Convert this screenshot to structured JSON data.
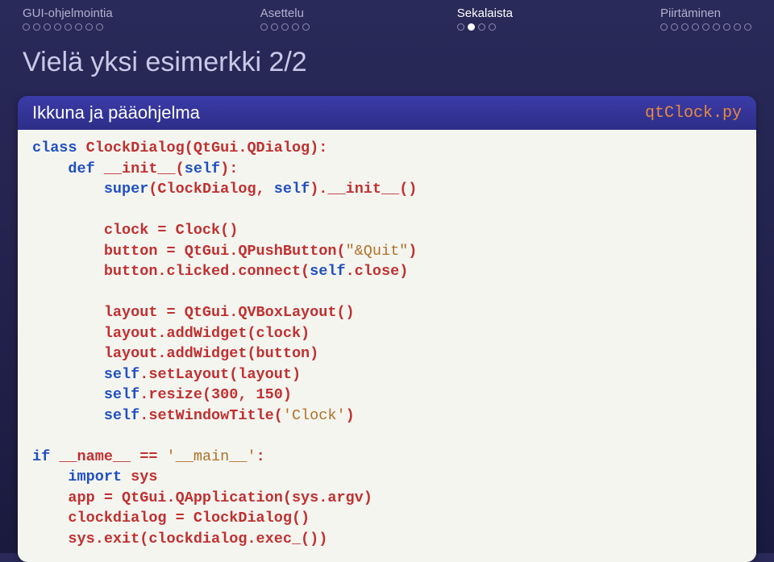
{
  "nav": {
    "items": [
      {
        "label": "GUI-ohjelmointia",
        "dot_count": 8,
        "filled_index": -1
      },
      {
        "label": "Asettelu",
        "dot_count": 5,
        "filled_index": -1
      },
      {
        "label": "Sekalaista",
        "dot_count": 4,
        "filled_index": 1
      },
      {
        "label": "Piirtäminen",
        "dot_count": 9,
        "filled_index": -1
      }
    ],
    "active_index": 2
  },
  "title": "Vielä yksi esimerkki 2/2",
  "block": {
    "heading": "Ikkuna ja pääohjelma",
    "filename": "qtClock.py"
  },
  "code": {
    "lines": [
      {
        "indent": 0,
        "parts": [
          {
            "t": "class",
            "c": "blue"
          },
          {
            "t": " ClockDialog(QtGui.QDialog):",
            "c": "red"
          }
        ]
      },
      {
        "indent": 1,
        "parts": [
          {
            "t": "def",
            "c": "blue"
          },
          {
            "t": " __init__(",
            "c": "red"
          },
          {
            "t": "self",
            "c": "blue"
          },
          {
            "t": "):",
            "c": "red"
          }
        ]
      },
      {
        "indent": 2,
        "parts": [
          {
            "t": "super",
            "c": "blue"
          },
          {
            "t": "(ClockDialog, ",
            "c": "red"
          },
          {
            "t": "self",
            "c": "blue"
          },
          {
            "t": ").__init__()",
            "c": "red"
          }
        ]
      },
      {
        "gap": true
      },
      {
        "indent": 2,
        "parts": [
          {
            "t": "clock = Clock()",
            "c": "red"
          }
        ]
      },
      {
        "indent": 2,
        "parts": [
          {
            "t": "button = QtGui.QPushButton(",
            "c": "red"
          },
          {
            "t": "\"&Quit\"",
            "c": "str"
          },
          {
            "t": ")",
            "c": "red"
          }
        ]
      },
      {
        "indent": 2,
        "parts": [
          {
            "t": "button.clicked.connect(",
            "c": "red"
          },
          {
            "t": "self",
            "c": "blue"
          },
          {
            "t": ".close)",
            "c": "red"
          }
        ]
      },
      {
        "gap": true
      },
      {
        "indent": 2,
        "parts": [
          {
            "t": "layout = QtGui.QVBoxLayout()",
            "c": "red"
          }
        ]
      },
      {
        "indent": 2,
        "parts": [
          {
            "t": "layout.addWidget(clock)",
            "c": "red"
          }
        ]
      },
      {
        "indent": 2,
        "parts": [
          {
            "t": "layout.addWidget(button)",
            "c": "red"
          }
        ]
      },
      {
        "indent": 2,
        "parts": [
          {
            "t": "self",
            "c": "blue"
          },
          {
            "t": ".setLayout(layout)",
            "c": "red"
          }
        ]
      },
      {
        "indent": 2,
        "parts": [
          {
            "t": "self",
            "c": "blue"
          },
          {
            "t": ".resize(300, 150)",
            "c": "red"
          }
        ]
      },
      {
        "indent": 2,
        "parts": [
          {
            "t": "self",
            "c": "blue"
          },
          {
            "t": ".setWindowTitle(",
            "c": "red"
          },
          {
            "t": "'Clock'",
            "c": "str"
          },
          {
            "t": ")",
            "c": "red"
          }
        ]
      },
      {
        "gap": true
      },
      {
        "indent": 0,
        "parts": [
          {
            "t": "if",
            "c": "blue"
          },
          {
            "t": " __name__ == ",
            "c": "red"
          },
          {
            "t": "'__main__'",
            "c": "str"
          },
          {
            "t": ":",
            "c": "red"
          }
        ]
      },
      {
        "indent": 1,
        "parts": [
          {
            "t": "import",
            "c": "blue"
          },
          {
            "t": " sys",
            "c": "red"
          }
        ]
      },
      {
        "indent": 1,
        "parts": [
          {
            "t": "app = QtGui.QApplication(sys.argv)",
            "c": "red"
          }
        ]
      },
      {
        "indent": 1,
        "parts": [
          {
            "t": "clockdialog = ClockDialog()",
            "c": "red"
          }
        ]
      },
      {
        "indent": 1,
        "parts": [
          {
            "t": "sys.exit(clockdialog.exec_())",
            "c": "red"
          }
        ]
      }
    ]
  }
}
